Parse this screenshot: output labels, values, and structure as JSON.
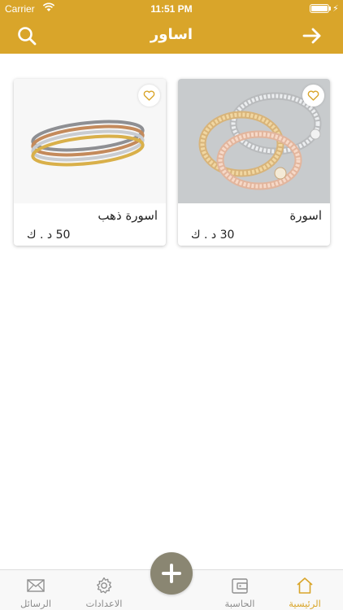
{
  "status_bar": {
    "carrier": "Carrier",
    "time": "11:51 PM"
  },
  "header": {
    "title": "اساور",
    "search_icon": "search-icon",
    "back_icon": "arrow-right-icon"
  },
  "products": [
    {
      "title": "اسورة",
      "price": "30 د . ك"
    },
    {
      "title": "اسورة ذهب",
      "price": "50 د . ك"
    }
  ],
  "tab_bar": {
    "items": [
      {
        "label": "الرئيسية",
        "icon": "home-icon",
        "active": true
      },
      {
        "label": "الحاسبة",
        "icon": "wallet-icon",
        "active": false
      },
      {
        "label": "الاعدادات",
        "icon": "gear-icon",
        "active": false
      },
      {
        "label": "الرسائل",
        "icon": "mail-icon",
        "active": false
      }
    ],
    "center_action": "plus-icon"
  },
  "colors": {
    "accent": "#d9a52a",
    "tab_inactive": "#8e8e8e",
    "fab": "#8a8672"
  }
}
